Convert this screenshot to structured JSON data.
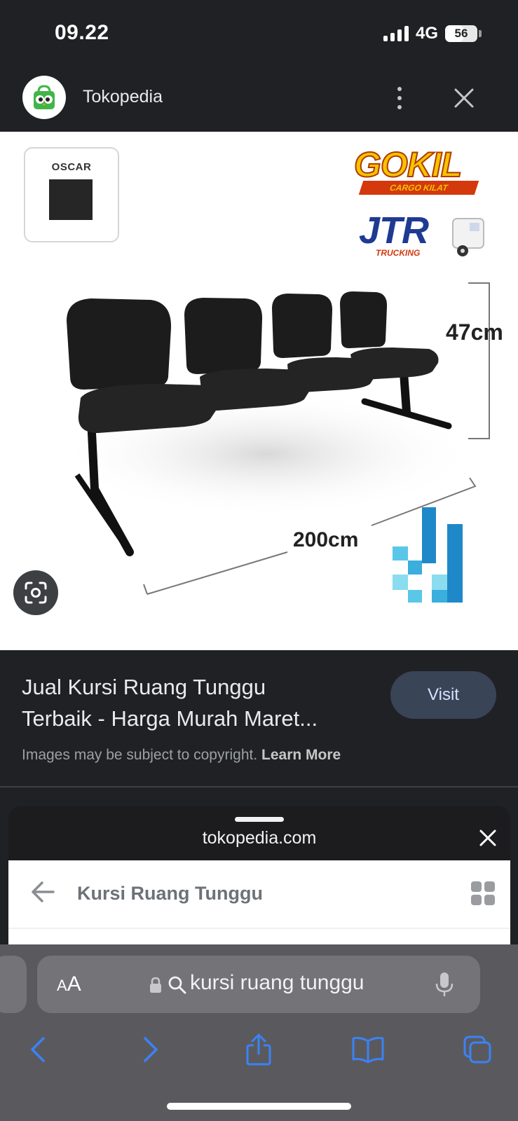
{
  "status_bar": {
    "time": "09.22",
    "network": "4G",
    "battery": "56",
    "battery_level": 0.56
  },
  "source": {
    "site_name": "Tokopedia",
    "logo": "tokopedia-owl-bag-logo",
    "menu_icon": "more-vertical-icon",
    "close_icon": "close-icon"
  },
  "product_image": {
    "swatch_label": "OSCAR",
    "brand_1": "GOKIL",
    "brand_1_sub": "CARGO KILAT",
    "brand_2": "JTR",
    "brand_2_sub": "TRUCKING",
    "height_dim": "47cm",
    "width_dim": "200cm",
    "lens_icon": "google-lens-icon"
  },
  "info": {
    "title_line1": "Jual Kursi Ruang Tunggu",
    "title_line2": "Terbaik - Harga Murah Maret...",
    "visit_label": "Visit",
    "copyright_text": "Images may be subject to copyright.",
    "learn_more": "Learn More"
  },
  "sheet": {
    "domain": "tokopedia.com",
    "page_search_text": "Kursi Ruang Tunggu"
  },
  "safari": {
    "aa_small": "A",
    "aa_big": "A",
    "address_text": "kursi ruang tunggu",
    "toolbar_icons": [
      "back-icon",
      "forward-icon",
      "share-icon",
      "bookmarks-icon",
      "tabs-icon"
    ]
  },
  "colors": {
    "background": "#202124",
    "visit_button": "#394457",
    "accent_blue": "#3b82f6",
    "safari_bar": "#5a5a5e"
  }
}
